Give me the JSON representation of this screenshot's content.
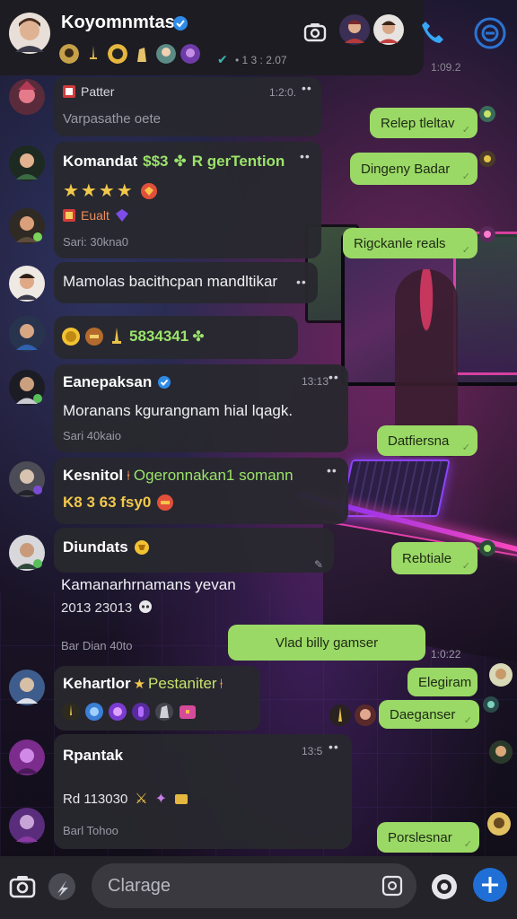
{
  "header": {
    "title": "Koyomnmtas",
    "timestamp": "• 1 3 : 2.07",
    "top_right_time": "1:09.2"
  },
  "messages_in": [
    {
      "sender": "Patter",
      "text": "Varpasathe oete",
      "time": "1:2:0."
    },
    {
      "sender": "Komandat",
      "name_suffix": "R gerTention",
      "name_prefix_code": "$$3",
      "stars": "★★★★",
      "sub_label": "Eualt",
      "foot": "Sari: 30kna0"
    },
    {
      "text": "Mamolas bacithcpan mandltikar"
    },
    {
      "text": "5834341"
    },
    {
      "sender": "Eanepaksan",
      "text": "Moranans kgurangnam hial lqagk.",
      "foot": "Sari 40kaio",
      "time": "13:13"
    },
    {
      "sender": "Kesnitol",
      "name_suffix": "Ogeronnakan1 somann",
      "text": "K8 3 63 fsy0"
    },
    {
      "sender": "Diundats",
      "text": "Kamanarhrnamans yevan",
      "num": "2013 23013",
      "foot": "Bar Dian 40to"
    },
    {
      "sender": "Kehartlor",
      "name_suffix": "Pestaniter"
    },
    {
      "sender": "Rpantak",
      "text": "Rd 113030",
      "foot": "Barl Tohoo",
      "time": "13:5"
    }
  ],
  "messages_out": [
    {
      "text": "Relep tleltav"
    },
    {
      "text": "Dingeny Badar"
    },
    {
      "text": "Rigckanle reals"
    },
    {
      "text": "Datfiersna"
    },
    {
      "text": "Rebtiale"
    },
    {
      "text": "Vlad billy gamser",
      "time": "1:0:22"
    },
    {
      "text": "Elegiram"
    },
    {
      "text": "Daeganser"
    },
    {
      "text": "Porslesnar"
    }
  ],
  "composer": {
    "placeholder": "Clarage"
  },
  "colors": {
    "outgoing_bubble": "#9bd966",
    "incoming_bubble": "#28282e",
    "accent_blue": "#1f6fd6",
    "neon_pink": "#ff47b8",
    "neon_purple": "#8d44ff"
  },
  "icons": [
    "camera-icon",
    "video-call-icon",
    "phone-icon",
    "menu-icon",
    "verified-icon",
    "send-icon",
    "attach-icon",
    "sticker-icon"
  ]
}
